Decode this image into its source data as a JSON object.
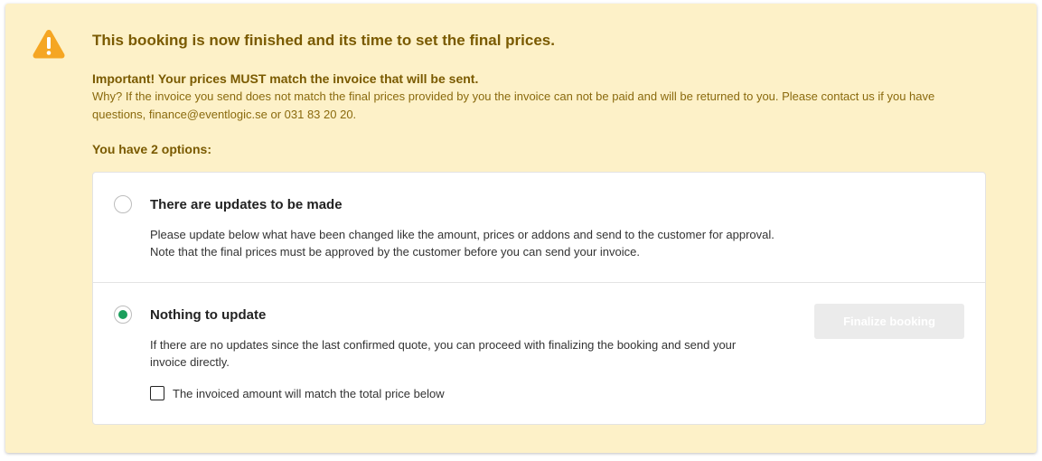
{
  "alert": {
    "title": "This booking is now finished and its time to set the final prices.",
    "important": "Important! Your prices MUST match the invoice that will be sent.",
    "why": "Why? If the invoice you send does not match the final prices provided by you the invoice can not be paid and will be returned to you. Please contact us if you have questions, finance@eventlogic.se or 031 83 20 20.",
    "options_heading": "You have 2 options:",
    "icon": "warning-icon",
    "colors": {
      "background": "#fdf1c8",
      "text": "#7a5a00",
      "icon": "#f5a623",
      "selected_radio": "#1a9f5c"
    }
  },
  "options": [
    {
      "title": "There are updates to be made",
      "description_line1": "Please update below what have been changed like the amount, prices or addons and send to the customer for approval.",
      "description_line2": "Note that the final prices must be approved by the customer before you can send your invoice.",
      "selected": false
    },
    {
      "title": "Nothing to update",
      "description": "If there are no updates since the last confirmed quote, you can proceed with finalizing the booking and send your invoice directly.",
      "selected": true,
      "button_label": "Finalize booking",
      "button_disabled": true,
      "checkbox_label": "The invoiced amount will match the total price below",
      "checkbox_checked": false
    }
  ]
}
